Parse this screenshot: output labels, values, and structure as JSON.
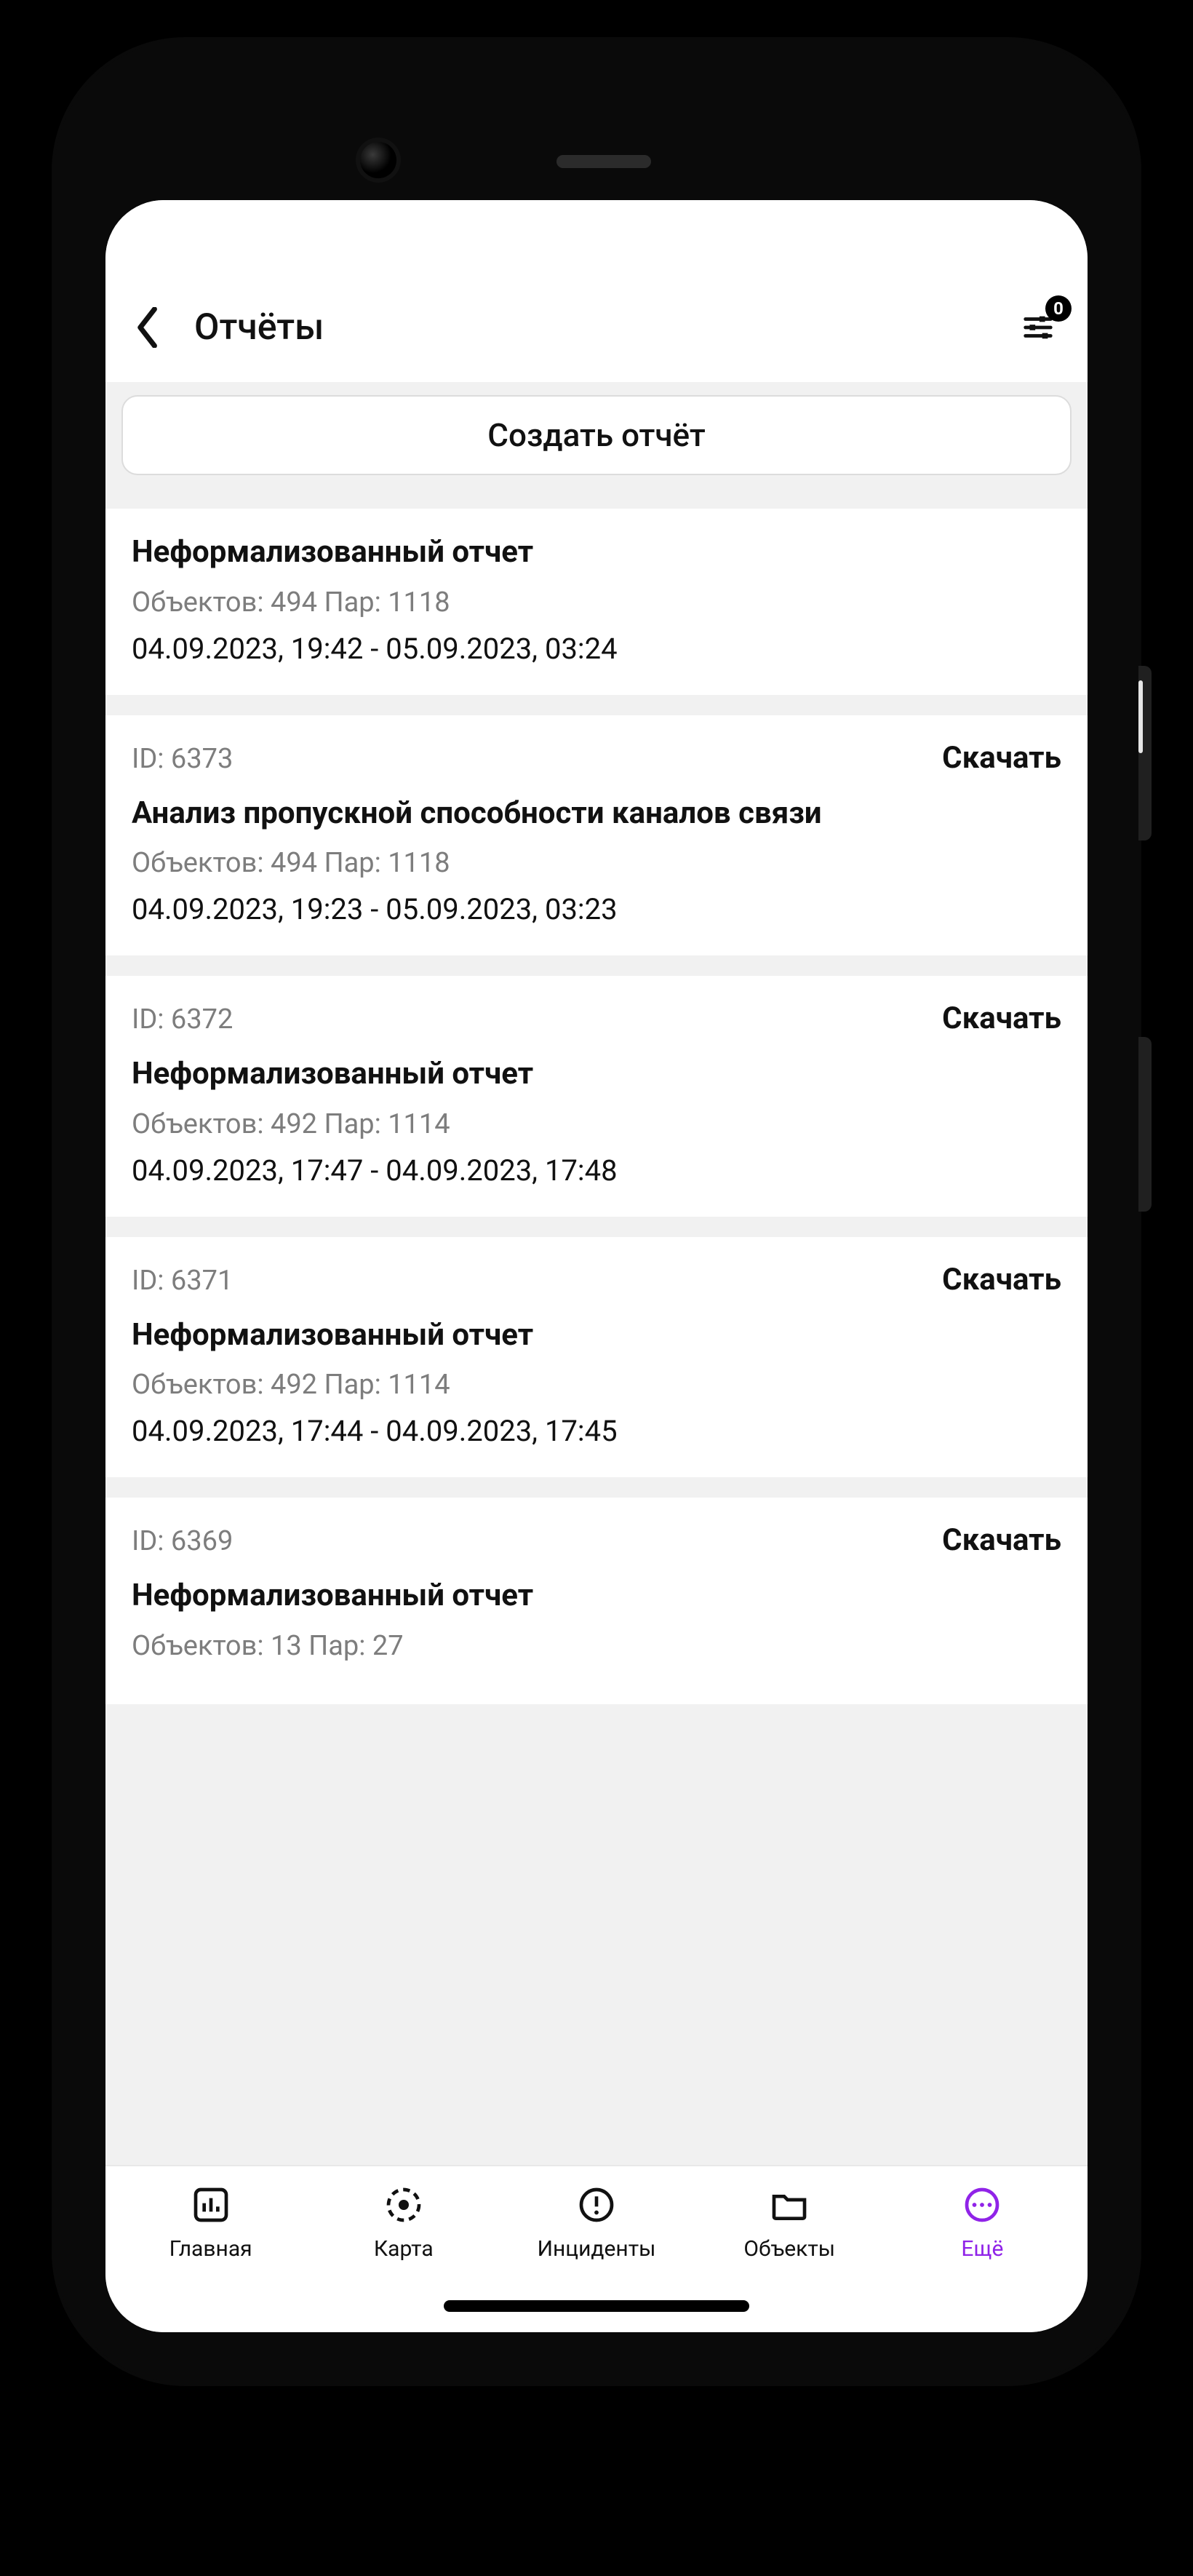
{
  "header": {
    "title": "Отчёты",
    "filter_badge": "0"
  },
  "create_button_label": "Создать отчёт",
  "download_label": "Скачать",
  "id_prefix": "ID: ",
  "stats_obj_prefix": "Объектов: ",
  "stats_pairs_prefix": " Пар: ",
  "reports": [
    {
      "id": "",
      "title": "Неформализованный отчет",
      "objects": "494",
      "pairs": "1118",
      "dates": "04.09.2023, 19:42 - 05.09.2023, 03:24",
      "has_id": false
    },
    {
      "id": "6373",
      "title": "Анализ пропускной способности каналов связи",
      "objects": "494",
      "pairs": "1118",
      "dates": "04.09.2023, 19:23 - 05.09.2023, 03:23",
      "has_id": true
    },
    {
      "id": "6372",
      "title": "Неформализованный отчет",
      "objects": "492",
      "pairs": "1114",
      "dates": "04.09.2023, 17:47 - 04.09.2023, 17:48",
      "has_id": true
    },
    {
      "id": "6371",
      "title": "Неформализованный отчет",
      "objects": "492",
      "pairs": "1114",
      "dates": "04.09.2023, 17:44 - 04.09.2023, 17:45",
      "has_id": true
    },
    {
      "id": "6369",
      "title": "Неформализованный отчет",
      "objects": "13",
      "pairs": "27",
      "dates": "",
      "has_id": true,
      "partial": true
    }
  ],
  "nav": {
    "items": [
      {
        "label": "Главная",
        "icon": "bar-chart-icon"
      },
      {
        "label": "Карта",
        "icon": "map-pin-dashed-icon"
      },
      {
        "label": "Инциденты",
        "icon": "alert-circle-icon"
      },
      {
        "label": "Объекты",
        "icon": "folder-icon"
      },
      {
        "label": "Ещё",
        "icon": "more-icon",
        "active": true
      }
    ]
  }
}
